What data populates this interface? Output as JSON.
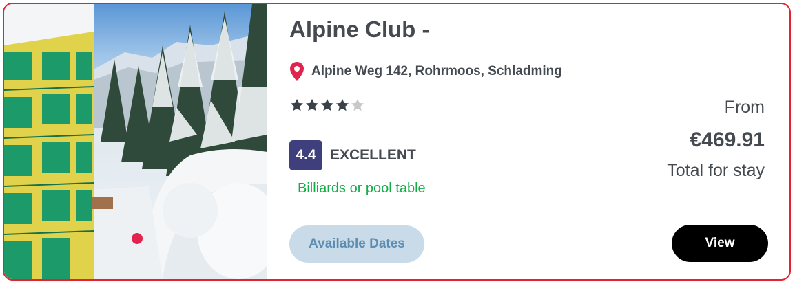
{
  "hotel": {
    "name": "Alpine Club -",
    "address": "Alpine Weg 142, Rohrmoos, Schladming",
    "stars": 4,
    "max_stars": 5,
    "rating_score": "4.4",
    "rating_word": "EXCELLENT",
    "amenity": "Billiards or pool table"
  },
  "pricing": {
    "from_label": "From",
    "price": "€469.91",
    "total_label": "Total for stay"
  },
  "actions": {
    "available_dates_label": "Available Dates",
    "view_label": "View"
  },
  "photo": {
    "description": "snowy forest path beside green and yellow chalet building",
    "carousel_dot_color": "#e0244e"
  },
  "colors": {
    "card_border": "#e3232e",
    "rating_badge": "#3e3f7c",
    "amenity_text": "#13ad47",
    "available_button_bg": "#c9dbe8",
    "view_button_bg": "#000000",
    "star_filled": "#3a4149",
    "star_empty": "#c8c8c8"
  },
  "icons": {
    "location": "map-pin-icon",
    "star": "star-icon"
  }
}
